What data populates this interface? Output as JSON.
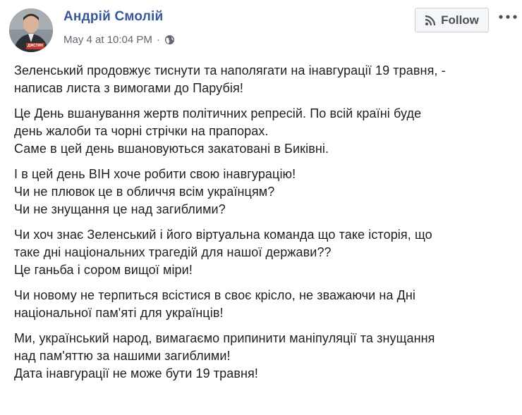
{
  "post": {
    "author": "Андрій Смолій",
    "timestamp": "May 4 at 10:04 PM",
    "separator": "·",
    "privacy_icon": "globe-icon",
    "follow_label": "Follow",
    "follow_icon": "rss-icon",
    "more_icon": "more-options-icon",
    "avatar_badge": "ДЖСТИН",
    "paragraphs": [
      [
        "Зеленський продовжує тиснути та наполягати на інавгурації 19 травня, -",
        "написав листа з вимогами до Парубія!"
      ],
      [
        "Це День вшанування жертв політичних репресій. По всій країні буде",
        "день жалоби та чорні стрічки на прапорах.",
        "Саме в цей день вшановуються закатовані в Биківні."
      ],
      [
        "І в цей день ВІН хоче робити свою інавгурацію!",
        "Чи не плювок це в обличчя всім українцям?",
        "Чи не знущання це над загиблими?"
      ],
      [
        "Чи хоч знає Зеленський і його віртуальна команда що таке історія, що",
        "таке дні національних трагедій для нашої держави??",
        "Це ганьба і сором вищої міри!"
      ],
      [
        "Чи новому не терпиться всістися в своє крісло, не зважаючи на Дні",
        "національної пам'яті для українців!"
      ],
      [
        "Ми, український народ, вимагаємо припинити маніпуляції та знущання",
        "над пам'яттю за нашими загиблими!",
        "Дата інавгурації не може бути 19 травня!"
      ]
    ]
  },
  "colors": {
    "author": "#365899",
    "meta": "#616770",
    "text": "#1c1e21",
    "follow_bg": "#f5f6f7",
    "follow_border": "#ccd0d5"
  }
}
